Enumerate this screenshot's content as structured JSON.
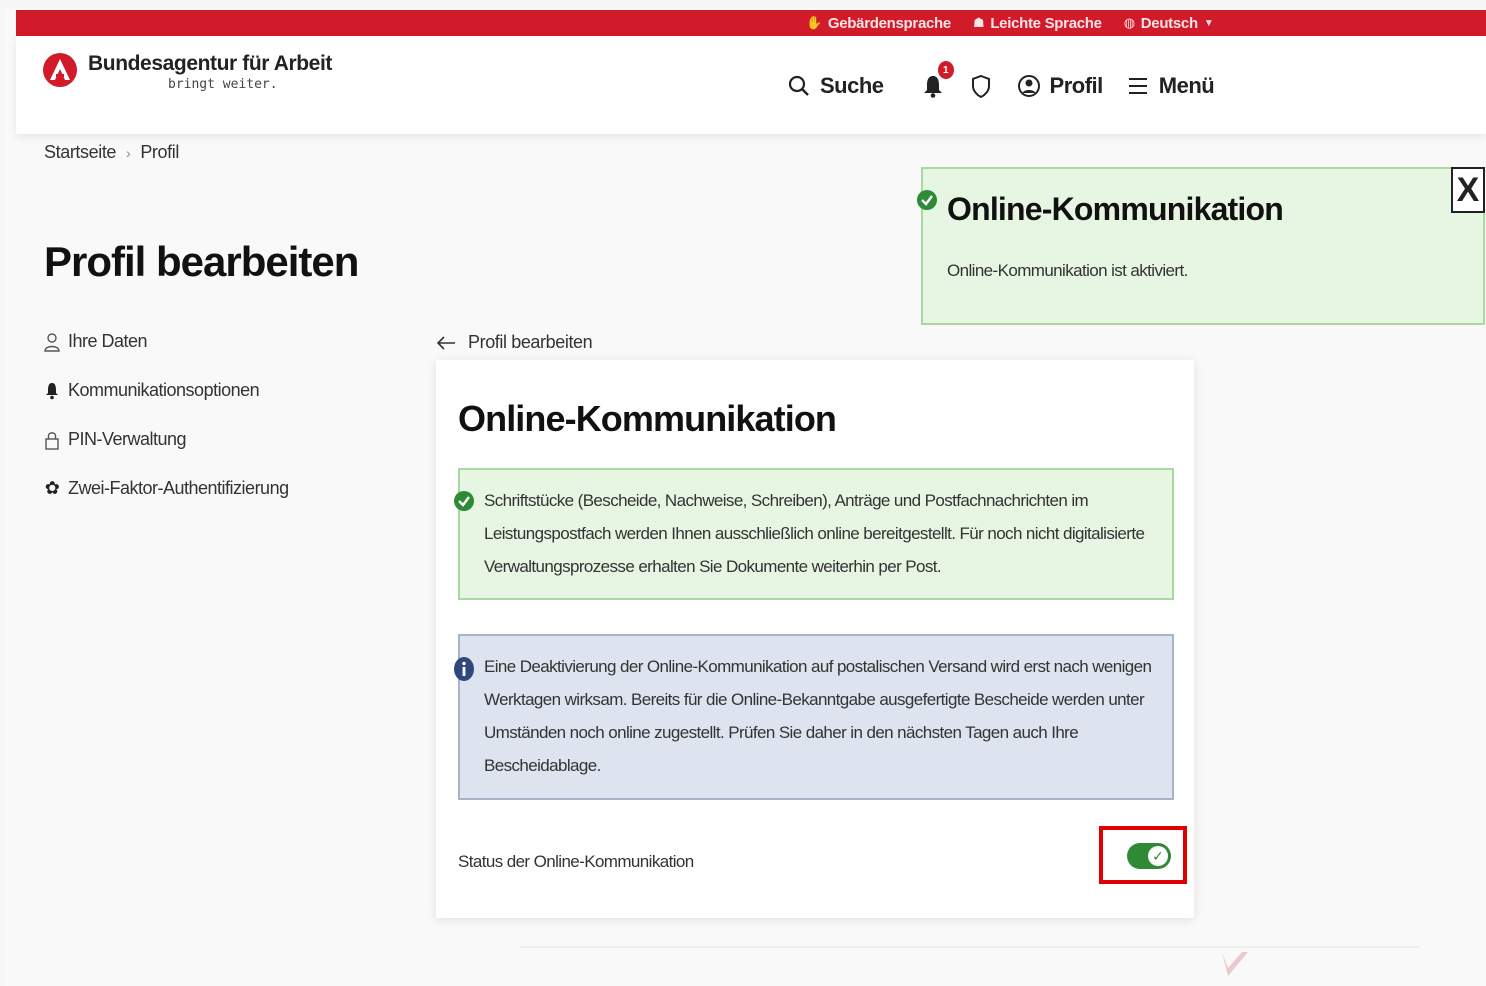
{
  "topbar": {
    "links": [
      {
        "icon": "hand-icon",
        "label": "Gebärdensprache"
      },
      {
        "icon": "easy-language-icon",
        "label": "Leichte Sprache"
      },
      {
        "icon": "globe-icon",
        "label": "Deutsch"
      }
    ]
  },
  "header": {
    "logo_title": "Bundesagentur für Arbeit",
    "logo_sub": "bringt weiter.",
    "nav": {
      "search_label": "Suche",
      "notification_count": "1",
      "profile_label": "Profil",
      "menu_label": "Menü"
    }
  },
  "breadcrumb": {
    "home": "Startseite",
    "separator": "›",
    "current": "Profil"
  },
  "page_title": "Profil bearbeiten",
  "sidebar": {
    "items": [
      {
        "icon": "person-icon",
        "label": "Ihre Daten"
      },
      {
        "icon": "bell-icon",
        "label": "Kommunikationsoptionen"
      },
      {
        "icon": "lock-icon",
        "label": "PIN-Verwaltung"
      },
      {
        "icon": "gear-icon",
        "label": "Zwei-Faktor-Authentifizierung"
      }
    ]
  },
  "back_link": "Profil bearbeiten",
  "toast": {
    "title": "Online-Kommunikation",
    "message": "Online-Kommunikation ist aktiviert.",
    "close_label": "X"
  },
  "card": {
    "title": "Online-Kommunikation",
    "success_text": "Schriftstücke (Bescheide, Nachweise, Schreiben), Anträge und Postfachnachrichten im Leistungspostfach werden Ihnen ausschließlich online bereitgestellt. Für noch nicht digitalisierte Verwaltungsprozesse erhalten Sie Dokumente weiterhin per Post.",
    "info_text": "Eine Deaktivierung der Online-Kommunikation auf postalischen Versand wird erst nach wenigen Werktagen wirksam. Bereits für die Online-Bekanntgabe ausgefertigte Bescheide werden unter Umständen noch online zugestellt. Prüfen Sie daher in den nächsten Tagen auch Ihre Bescheidablage.",
    "status_label": "Status der Online-Kommunikation",
    "toggle_state": "on"
  },
  "colors": {
    "brand_red": "#d11a2a",
    "success_bg": "#e6f6e3",
    "success_border": "#a7d9a0",
    "info_bg": "#dde3ef",
    "toggle_green": "#2f8a35",
    "highlight": "#e00000"
  }
}
